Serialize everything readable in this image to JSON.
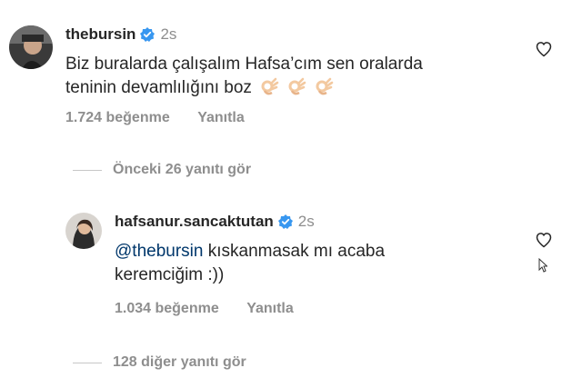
{
  "comment1": {
    "username": "thebursin",
    "time": "2s",
    "text_line1": "Biz buralarda çalışalım Hafsa’cım sen oralarda",
    "text_line2": "teninin devamlılığını boz",
    "emoji": "ok-hand-emoji",
    "likes": "1.724 beğenme",
    "reply": "Yanıtla"
  },
  "view_previous": "Önceki 26 yanıtı gör",
  "comment2": {
    "username": "hafsanur.sancaktutan",
    "time": "2s",
    "mention": "@thebursin",
    "text_line1_rest": " kıskanmasak mı acaba",
    "text_line2": "keremciğim :))",
    "likes": "1.034 beğenme",
    "reply": "Yanıtla"
  },
  "view_more": "128 diğer yanıtı gör",
  "colors": {
    "primary_text": "#262626",
    "secondary_text": "#8e8e8e",
    "mention": "#00376b",
    "verified": "#3897f0"
  }
}
